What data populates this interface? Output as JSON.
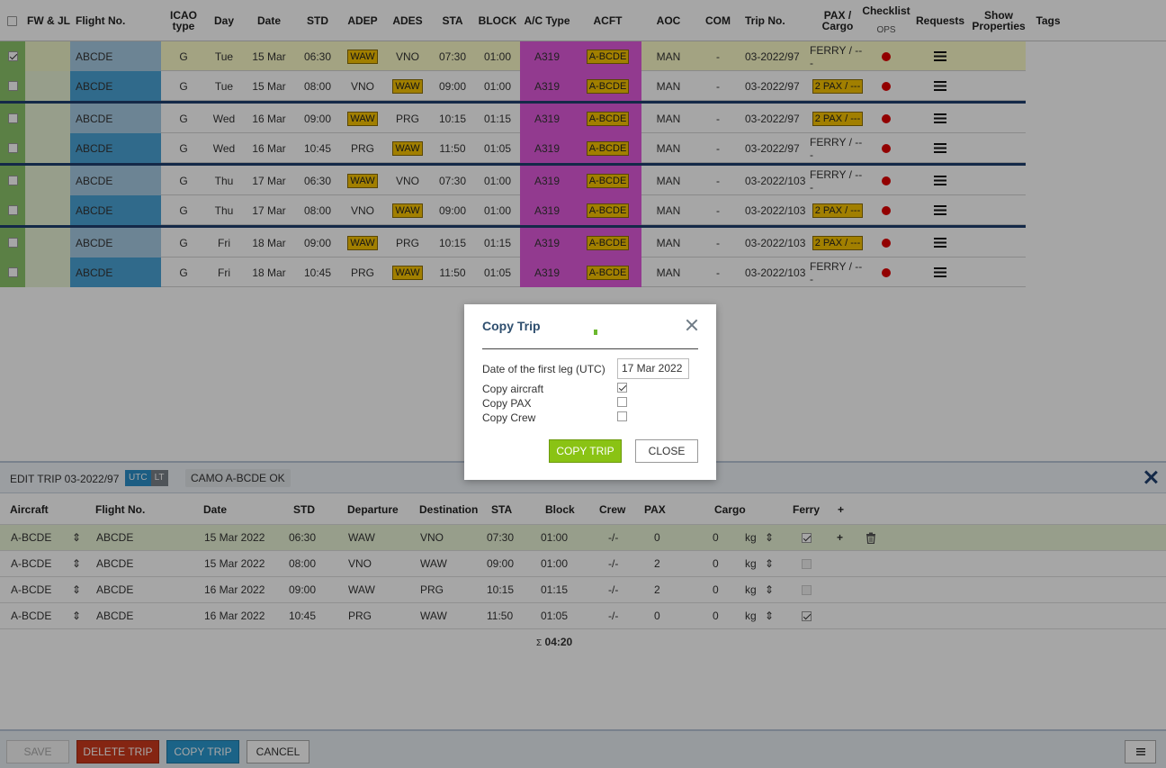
{
  "grid": {
    "headers": {
      "fw": "FW & JL",
      "flight_no": "Flight No.",
      "icao_line1": "ICAO",
      "icao_line2": "type",
      "day": "Day",
      "date": "Date",
      "std": "STD",
      "adep": "ADEP",
      "ades": "ADES",
      "sta": "STA",
      "block": "BLOCK",
      "ac_type": "A/C Type",
      "acft": "ACFT",
      "aoc": "AOC",
      "com": "COM",
      "trip_no": "Trip No.",
      "pax_line1": "PAX /",
      "pax_line2": "Cargo",
      "checklist": "Checklist",
      "ops": "OPS",
      "requests": "Requests",
      "show_line1": "Show",
      "show_line2": "Properties",
      "tags": "Tags"
    },
    "rows": [
      {
        "checked": true,
        "flight": "ABCDE",
        "icao": "G",
        "day": "Tue",
        "date": "15 Mar",
        "std": "06:30",
        "adep": "WAW",
        "ades": "VNO",
        "sta": "07:30",
        "block": "01:00",
        "ac_type": "A319",
        "acft": "A-BCDE",
        "aoc": "MAN",
        "com": "-",
        "trip": "03-2022/97",
        "pax": "FERRY / ---",
        "pax_tag": false,
        "adep_tag": true,
        "ades_tag": false,
        "flight_style": "light"
      },
      {
        "checked": false,
        "flight": "ABCDE",
        "icao": "G",
        "day": "Tue",
        "date": "15 Mar",
        "std": "08:00",
        "adep": "VNO",
        "ades": "WAW",
        "sta": "09:00",
        "block": "01:00",
        "ac_type": "A319",
        "acft": "A-BCDE",
        "aoc": "MAN",
        "com": "-",
        "trip": "03-2022/97",
        "pax": "2 PAX / ---",
        "pax_tag": true,
        "adep_tag": false,
        "ades_tag": true,
        "flight_style": "dark"
      },
      {
        "checked": false,
        "flight": "ABCDE",
        "icao": "G",
        "day": "Wed",
        "date": "16 Mar",
        "std": "09:00",
        "adep": "WAW",
        "ades": "PRG",
        "sta": "10:15",
        "block": "01:15",
        "ac_type": "A319",
        "acft": "A-BCDE",
        "aoc": "MAN",
        "com": "-",
        "trip": "03-2022/97",
        "pax": "2 PAX / ---",
        "pax_tag": true,
        "adep_tag": true,
        "ades_tag": false,
        "flight_style": "light"
      },
      {
        "checked": false,
        "flight": "ABCDE",
        "icao": "G",
        "day": "Wed",
        "date": "16 Mar",
        "std": "10:45",
        "adep": "PRG",
        "ades": "WAW",
        "sta": "11:50",
        "block": "01:05",
        "ac_type": "A319",
        "acft": "A-BCDE",
        "aoc": "MAN",
        "com": "-",
        "trip": "03-2022/97",
        "pax": "FERRY / ---",
        "pax_tag": false,
        "adep_tag": false,
        "ades_tag": true,
        "flight_style": "dark"
      },
      {
        "checked": false,
        "flight": "ABCDE",
        "icao": "G",
        "day": "Thu",
        "date": "17 Mar",
        "std": "06:30",
        "adep": "WAW",
        "ades": "VNO",
        "sta": "07:30",
        "block": "01:00",
        "ac_type": "A319",
        "acft": "A-BCDE",
        "aoc": "MAN",
        "com": "-",
        "trip": "03-2022/103",
        "pax": "FERRY / ---",
        "pax_tag": false,
        "adep_tag": true,
        "ades_tag": false,
        "flight_style": "light"
      },
      {
        "checked": false,
        "flight": "ABCDE",
        "icao": "G",
        "day": "Thu",
        "date": "17 Mar",
        "std": "08:00",
        "adep": "VNO",
        "ades": "WAW",
        "sta": "09:00",
        "block": "01:00",
        "ac_type": "A319",
        "acft": "A-BCDE",
        "aoc": "MAN",
        "com": "-",
        "trip": "03-2022/103",
        "pax": "2 PAX / ---",
        "pax_tag": true,
        "adep_tag": false,
        "ades_tag": true,
        "flight_style": "dark"
      },
      {
        "checked": false,
        "flight": "ABCDE",
        "icao": "G",
        "day": "Fri",
        "date": "18 Mar",
        "std": "09:00",
        "adep": "WAW",
        "ades": "PRG",
        "sta": "10:15",
        "block": "01:15",
        "ac_type": "A319",
        "acft": "A-BCDE",
        "aoc": "MAN",
        "com": "-",
        "trip": "03-2022/103",
        "pax": "2 PAX / ---",
        "pax_tag": true,
        "adep_tag": true,
        "ades_tag": false,
        "flight_style": "light"
      },
      {
        "checked": false,
        "flight": "ABCDE",
        "icao": "G",
        "day": "Fri",
        "date": "18 Mar",
        "std": "10:45",
        "adep": "PRG",
        "ades": "WAW",
        "sta": "11:50",
        "block": "01:05",
        "ac_type": "A319",
        "acft": "A-BCDE",
        "aoc": "MAN",
        "com": "-",
        "trip": "03-2022/103",
        "pax": "FERRY / ---",
        "pax_tag": false,
        "adep_tag": false,
        "ades_tag": true,
        "flight_style": "dark"
      }
    ],
    "checklist_icon": "red-dot-icon",
    "requests_icon": "hamburger-menu-icon"
  },
  "edit_trip": {
    "title": "EDIT TRIP 03-2022/97",
    "utc_label": "UTC",
    "lt_label": "LT",
    "camo": "CAMO A-BCDE OK",
    "headers": {
      "aircraft": "Aircraft",
      "flight_no": "Flight No.",
      "date": "Date",
      "std": "STD",
      "departure": "Departure",
      "destination": "Destination",
      "sta": "STA",
      "block": "Block",
      "crew": "Crew",
      "pax": "PAX",
      "cargo": "Cargo",
      "ferry": "Ferry"
    },
    "rows": [
      {
        "aircraft": "A-BCDE",
        "flight": "ABCDE",
        "date": "15 Mar 2022",
        "std": "06:30",
        "dep": "WAW",
        "dest": "VNO",
        "sta": "07:30",
        "block": "01:00",
        "crew": "-/-",
        "pax": "0",
        "cargo": "0",
        "unit": "kg",
        "ferry": true,
        "ferry_disabled": false
      },
      {
        "aircraft": "A-BCDE",
        "flight": "ABCDE",
        "date": "15 Mar 2022",
        "std": "08:00",
        "dep": "VNO",
        "dest": "WAW",
        "sta": "09:00",
        "block": "01:00",
        "crew": "-/-",
        "pax": "2",
        "cargo": "0",
        "unit": "kg",
        "ferry": false,
        "ferry_disabled": true
      },
      {
        "aircraft": "A-BCDE",
        "flight": "ABCDE",
        "date": "16 Mar 2022",
        "std": "09:00",
        "dep": "WAW",
        "dest": "PRG",
        "sta": "10:15",
        "block": "01:15",
        "crew": "-/-",
        "pax": "2",
        "cargo": "0",
        "unit": "kg",
        "ferry": false,
        "ferry_disabled": true
      },
      {
        "aircraft": "A-BCDE",
        "flight": "ABCDE",
        "date": "16 Mar 2022",
        "std": "10:45",
        "dep": "PRG",
        "dest": "WAW",
        "sta": "11:50",
        "block": "01:05",
        "crew": "-/-",
        "pax": "0",
        "cargo": "0",
        "unit": "kg",
        "ferry": true,
        "ferry_disabled": false
      }
    ],
    "total_symbol": "Σ",
    "total_block": "04:20"
  },
  "toolbar": {
    "save": "SAVE",
    "delete": "DELETE TRIP",
    "copy": "COPY TRIP",
    "cancel": "CANCEL",
    "menu_icon": "hamburger-menu-icon"
  },
  "modal": {
    "title": "Copy Trip",
    "date_label": "Date of the first leg (UTC)",
    "date_value": "17 Mar 2022",
    "copy_aircraft_label": "Copy aircraft",
    "copy_aircraft": true,
    "copy_pax_label": "Copy PAX",
    "copy_pax": false,
    "copy_crew_label": "Copy Crew",
    "copy_crew": false,
    "copy_button": "COPY TRIP",
    "close_button": "CLOSE"
  },
  "colors": {
    "green": "#8cc56a",
    "flight_light": "#a7cbe4",
    "flight_dark": "#4aa3d6",
    "magenta": "#e05adc",
    "tag_yellow": "#f7c300",
    "trip_separator": "#1f3f6f",
    "copy_green": "#8ac314",
    "delete_red": "#cc3a1d",
    "copy_blue": "#2a99d0"
  }
}
